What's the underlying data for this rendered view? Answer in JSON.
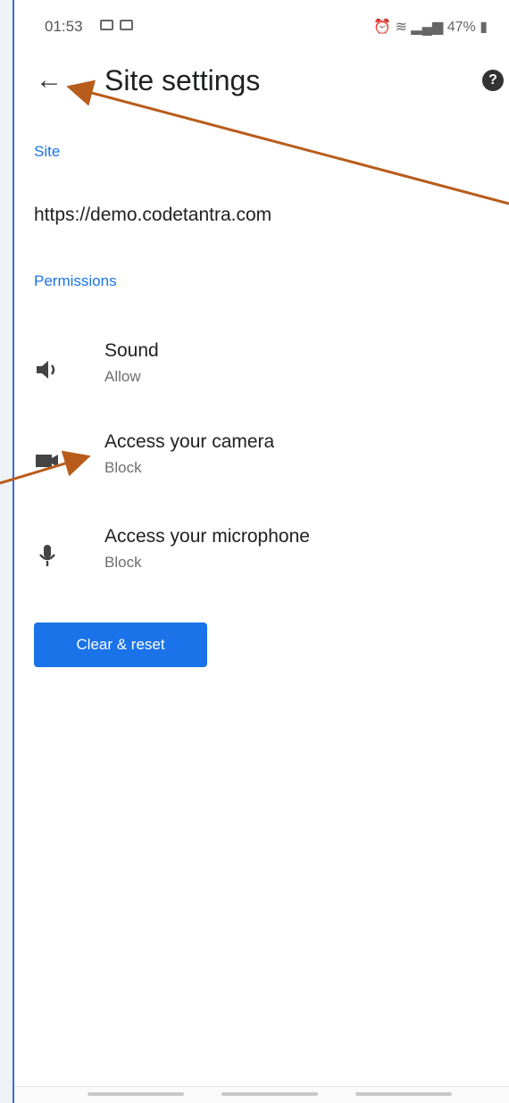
{
  "status_bar": {
    "time": "01:53",
    "right_text": "47%"
  },
  "toolbar": {
    "title": "Site settings",
    "back_glyph": "←",
    "help_glyph": "?"
  },
  "site": {
    "section_label": "Site",
    "url": "https://demo.codetantra.com"
  },
  "permissions": {
    "section_label": "Permissions",
    "items": [
      {
        "title": "Sound",
        "value": "Allow",
        "icon": "speaker-icon"
      },
      {
        "title": "Access your camera",
        "value": "Block",
        "icon": "camera-icon"
      },
      {
        "title": "Access your microphone",
        "value": "Block",
        "icon": "microphone-icon"
      }
    ]
  },
  "actions": {
    "clear_reset_label": "Clear & reset"
  },
  "colors": {
    "accent": "#1a73e8",
    "annotation_arrow": "#b85c1c"
  }
}
